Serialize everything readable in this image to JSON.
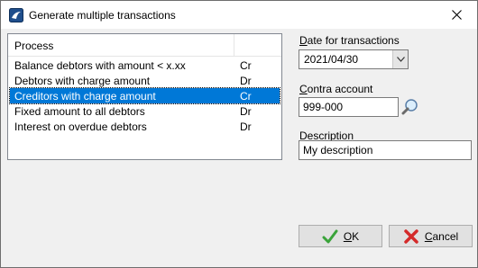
{
  "window": {
    "title": "Generate multiple transactions"
  },
  "list": {
    "header": "Process",
    "rows": [
      {
        "process": "Balance debtors with amount < x.xx",
        "type": "Cr",
        "selected": false
      },
      {
        "process": "Debtors with charge amount",
        "type": "Dr",
        "selected": false
      },
      {
        "process": "Creditors with charge amount",
        "type": "Cr",
        "selected": true
      },
      {
        "process": "Fixed amount to all debtors",
        "type": "Dr",
        "selected": false
      },
      {
        "process": "Interest on overdue debtors",
        "type": "Dr",
        "selected": false
      }
    ]
  },
  "date": {
    "label_first": "D",
    "label_rest": "ate for transactions",
    "value": "2021/04/30"
  },
  "contra": {
    "label_first": "C",
    "label_rest": "ontra account",
    "value": "999-000"
  },
  "description": {
    "label_first": "D",
    "label_rest": "escription",
    "value": "My description"
  },
  "buttons": {
    "ok_first": "O",
    "ok_rest": "K",
    "cancel_first": "C",
    "cancel_rest": "ancel"
  },
  "colors": {
    "selection": "#0078d7",
    "ok_check": "#3aa33a",
    "cancel_x": "#d42a2a"
  }
}
